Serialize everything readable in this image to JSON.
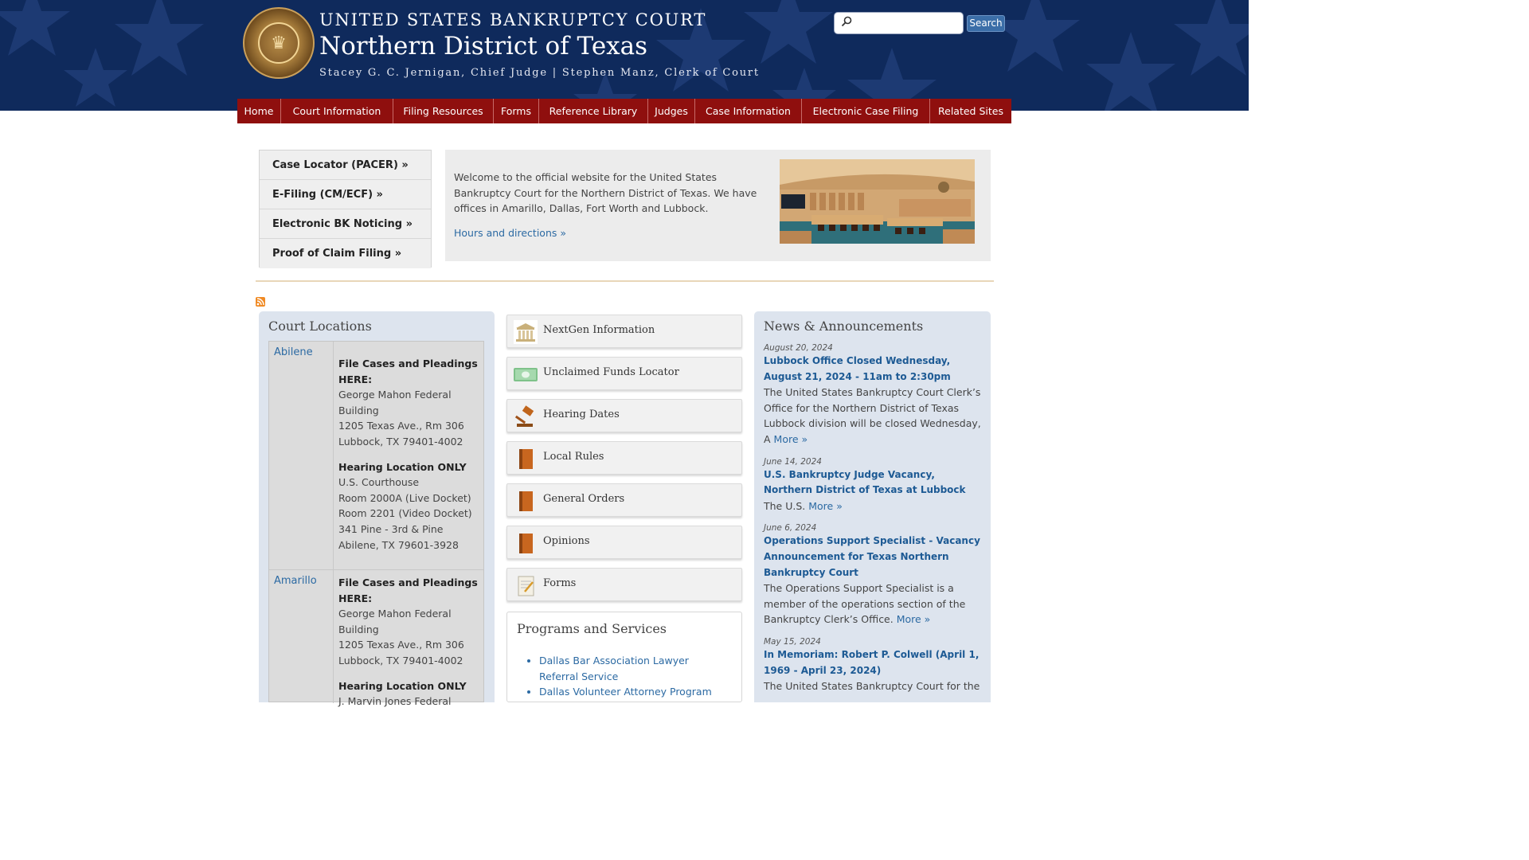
{
  "header": {
    "court_title": "UNITED STATES BANKRUPTCY COURT",
    "district": "Northern District of Texas",
    "judges": "Stacey G. C. Jernigan, Chief Judge | Stephen Manz, Clerk of Court",
    "search_placeholder": "",
    "search_button": "Search",
    "bg_color": "#0f2a5c"
  },
  "nav": {
    "items": [
      "Home",
      "Court Information",
      "Filing Resources",
      "Forms",
      "Reference Library",
      "Judges",
      "Case Information",
      "Electronic Case Filing",
      "Related Sites"
    ],
    "bg_color": "#8f0f0e"
  },
  "quick_links": [
    "Case Locator (PACER) »",
    "E-Filing (CM/ECF) »",
    "Electronic BK Noticing »",
    "Proof of Claim Filing »"
  ],
  "welcome": {
    "text": "Welcome to the official website for the United States Bankruptcy Court for the Northern District of Texas. We have offices in Amarillo, Dallas, Fort Worth and Lubbock.",
    "link": "Hours and directions »"
  },
  "locations": {
    "title": "Court Locations",
    "rows": [
      {
        "city": "Abilene",
        "file_heading": "File Cases and Pleadings HERE:",
        "file_lines": [
          "George Mahon Federal Building",
          "1205 Texas Ave., Rm 306",
          "Lubbock, TX 79401-4002"
        ],
        "hearing_heading": "Hearing Location ONLY",
        "hearing_lines": [
          "U.S. Courthouse",
          "Room 2000A (Live Docket)",
          "Room 2201 (Video Docket)",
          "341 Pine - 3rd & Pine",
          "Abilene, TX 79601-3928"
        ]
      },
      {
        "city": "Amarillo",
        "file_heading": "File Cases and Pleadings HERE:",
        "file_lines": [
          "George Mahon Federal Building",
          "1205 Texas Ave., Rm 306",
          "Lubbock, TX 79401-4002"
        ],
        "hearing_heading": "Hearing Location ONLY",
        "hearing_lines": [
          "J. Marvin Jones Federal"
        ]
      }
    ]
  },
  "tiles": [
    {
      "label": "NextGen Information",
      "icon": "courthouse-icon"
    },
    {
      "label": "Unclaimed Funds Locator",
      "icon": "money-icon"
    },
    {
      "label": "Hearing Dates",
      "icon": "gavel-icon"
    },
    {
      "label": "Local Rules",
      "icon": "book-icon"
    },
    {
      "label": "General Orders",
      "icon": "book-icon"
    },
    {
      "label": "Opinions",
      "icon": "book-icon"
    },
    {
      "label": "Forms",
      "icon": "form-icon"
    }
  ],
  "programs": {
    "title": "Programs and Services",
    "items": [
      "Dallas Bar Association Lawyer Referral Service",
      "Dallas Volunteer Attorney Program"
    ]
  },
  "news": {
    "title": "News & Announcements",
    "more_label": "More »",
    "items": [
      {
        "date": "August 20, 2024",
        "headline": "Lubbock Office Closed Wednesday, August 21, 2024 - 11am to 2:30pm",
        "body": "The United States Bankruptcy Court Clerk’s Office for the Northern District of Texas Lubbock division will be closed Wednesday, A"
      },
      {
        "date": "June 14, 2024",
        "headline": "U.S. Bankruptcy Judge Vacancy, Northern District of Texas at Lubbock",
        "body": "The U.S."
      },
      {
        "date": "June 6, 2024",
        "headline": "Operations Support Specialist - Vacancy Announcement for Texas Northern Bankruptcy Court",
        "body": "The Operations Support Specialist is a member of the operations section of the Bankruptcy Clerk’s Office."
      },
      {
        "date": "May 15, 2024",
        "headline": "In Memoriam: Robert P. Colwell (April 1, 1969 - April 23, 2024)",
        "body": "The United States Bankruptcy Court for the"
      }
    ]
  }
}
